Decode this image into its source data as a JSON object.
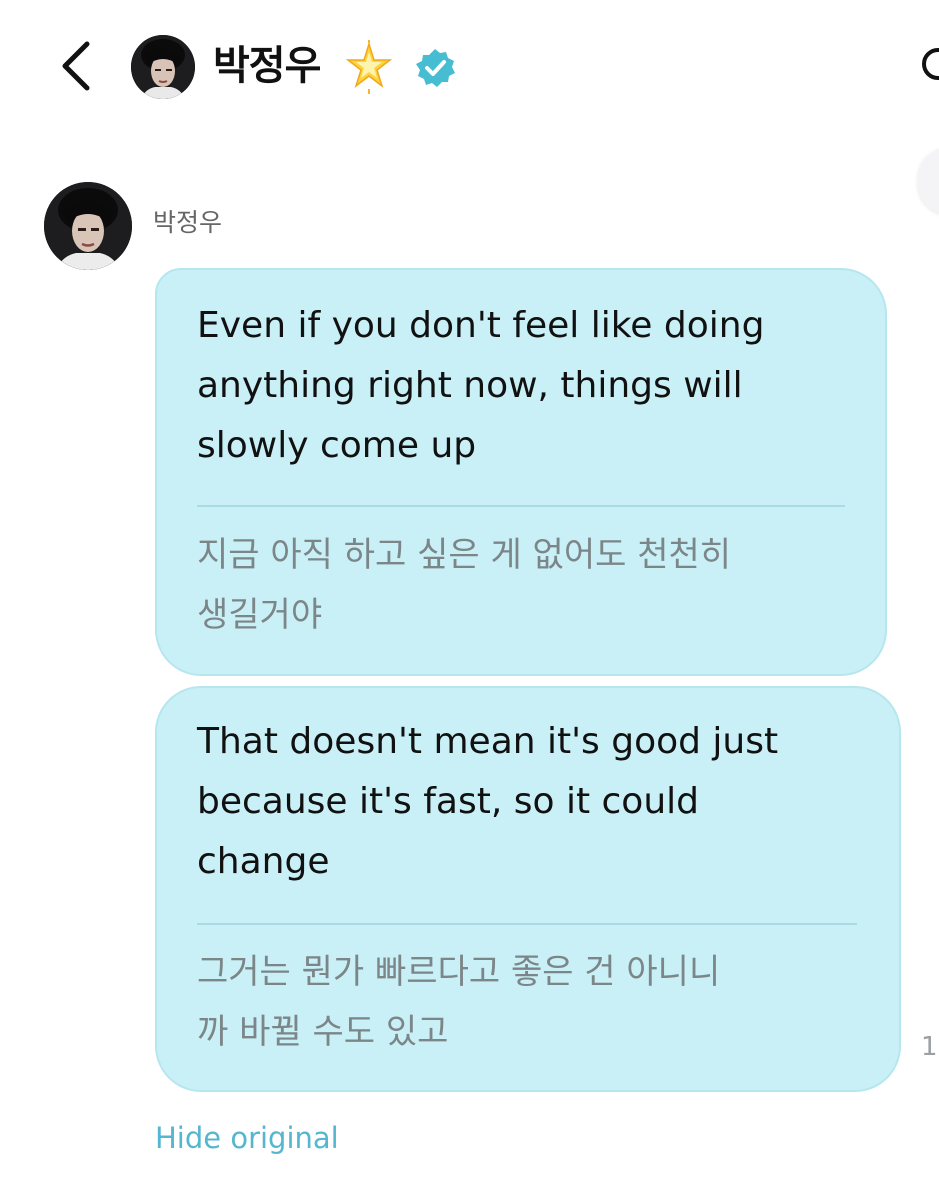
{
  "header": {
    "back_icon": "chevron-left-icon",
    "name": "박정우",
    "star_icon": "glowing-star-icon",
    "verified_icon": "verified-badge-icon",
    "search_icon": "search-icon"
  },
  "conversation": {
    "sender_name": "박정우",
    "messages": [
      {
        "english": "Even if you don't feel like doing\nanything right now, things will\nslowly come up",
        "korean": "지금 아직 하고 싶은 게 없어도 천천히\n생길거야"
      },
      {
        "english": "That doesn't mean it's good just\nbecause it's fast, so it could\nchange",
        "korean": "그거는 뭔가 빠르다고 좋은 건 아니니\n까 바뀔 수도 있고"
      }
    ],
    "time_fragment": "1",
    "hide_original_label": "Hide original"
  },
  "colors": {
    "bubble": "#c8f0f6",
    "bubble_border": "#b6e6ee",
    "link": "#55b7cf",
    "verified": "#46bdd1",
    "translation_text": "#7c8689"
  }
}
